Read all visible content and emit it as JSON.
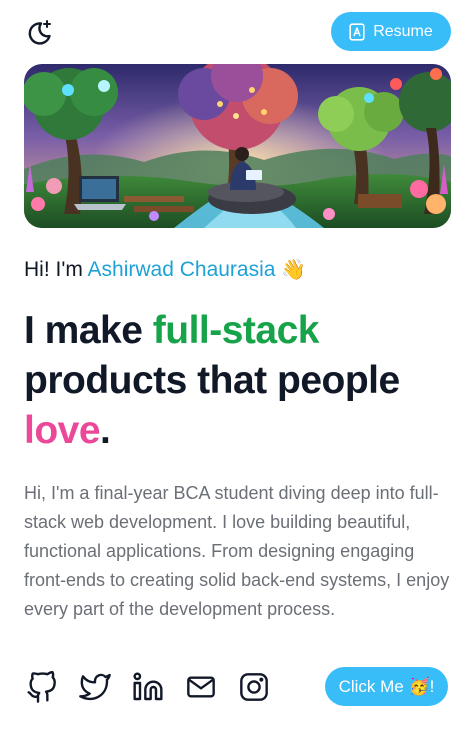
{
  "header": {
    "theme_toggle_icon": "moon-sparkle-icon",
    "resume_icon": "document-icon",
    "resume_label": "Resume"
  },
  "hero": {
    "image": "illustration of a person with a laptop sitting on a rock by a stream under colorful glowing trees"
  },
  "greeting": {
    "prefix": "Hi! I'm ",
    "name": "Ashirwad Chaurasia",
    "emoji": "👋"
  },
  "headline": {
    "part1": "I make ",
    "highlight": "full-stack",
    "part2": " products that people ",
    "accent": "love",
    "end": "."
  },
  "bio": "Hi, I'm a final-year BCA student diving deep into full-stack web development. I love building beautiful, functional applications. From designing engaging front-ends to creating solid back-end systems, I enjoy every part of the development process.",
  "socials": [
    {
      "icon": "github-icon"
    },
    {
      "icon": "twitter-icon"
    },
    {
      "icon": "linkedin-icon"
    },
    {
      "icon": "mail-icon"
    },
    {
      "icon": "instagram-icon"
    }
  ],
  "contact_label": "Click Me 🥳!",
  "colors": {
    "accent": "#38bdf8",
    "name": "#1ea1d6",
    "highlight_green": "#16a34a",
    "highlight_pink": "#ec4899",
    "text": "#111827",
    "muted": "#6b6f76"
  }
}
